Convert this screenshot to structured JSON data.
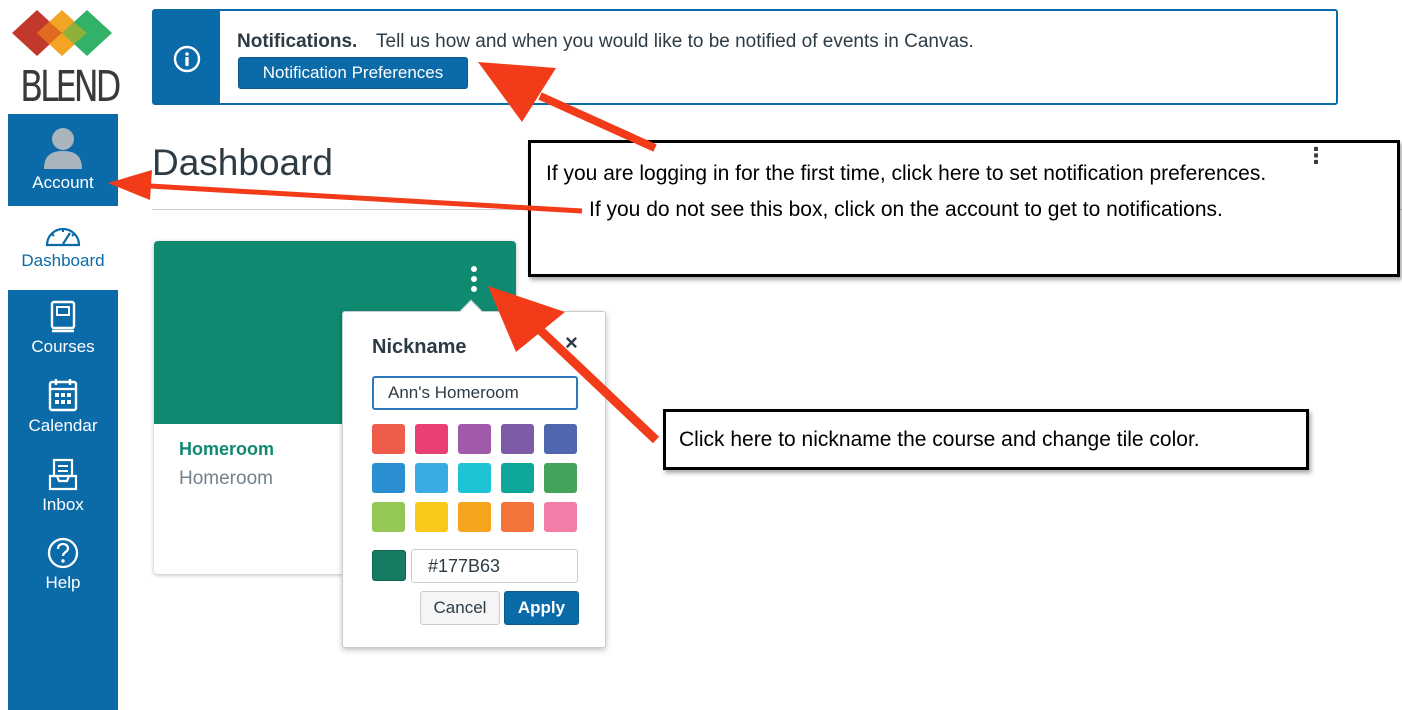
{
  "brand": {
    "logo_text": "BLEND",
    "logo_colors": [
      "#c0392b",
      "#f39c12",
      "#27ae60"
    ]
  },
  "sidebar": {
    "items": [
      {
        "label": "Account",
        "icon": "user-avatar-icon"
      },
      {
        "label": "Dashboard",
        "icon": "speedometer-icon"
      },
      {
        "label": "Courses",
        "icon": "book-icon"
      },
      {
        "label": "Calendar",
        "icon": "calendar-icon"
      },
      {
        "label": "Inbox",
        "icon": "inbox-icon"
      },
      {
        "label": "Help",
        "icon": "question-circle-icon"
      }
    ]
  },
  "notification": {
    "icon": "info-circle-icon",
    "title": "Notifications.",
    "text": "Tell us how and when you would like to be notified of events in Canvas.",
    "button_label": "Notification Preferences"
  },
  "dashboard": {
    "title": "Dashboard"
  },
  "course_card": {
    "name": "Homeroom",
    "term": "Homeroom",
    "color": "#0f8a70"
  },
  "nickname_popover": {
    "title": "Nickname",
    "close_symbol": "×",
    "nickname_value": "Ann's Homeroom",
    "swatches": [
      "#f05c4c",
      "#ea3f72",
      "#a25bab",
      "#7d5ba6",
      "#5067b0",
      "#2a8fd0",
      "#3aace3",
      "#1fc3d6",
      "#0ea89a",
      "#43a35a",
      "#94c755",
      "#f8c81a",
      "#f7a41f",
      "#f3743a",
      "#f37ca8"
    ],
    "hex_value": "#177B63",
    "cancel_label": "Cancel",
    "apply_label": "Apply"
  },
  "annotations": {
    "top_line1": "If you are logging in for the first time, click here to set notification preferences.",
    "top_line2": "If you do not see this box, click on the account to get to notifications.",
    "bottom_line": "Click here to nickname the course and change tile color.",
    "arrow_color": "#f23c19"
  }
}
